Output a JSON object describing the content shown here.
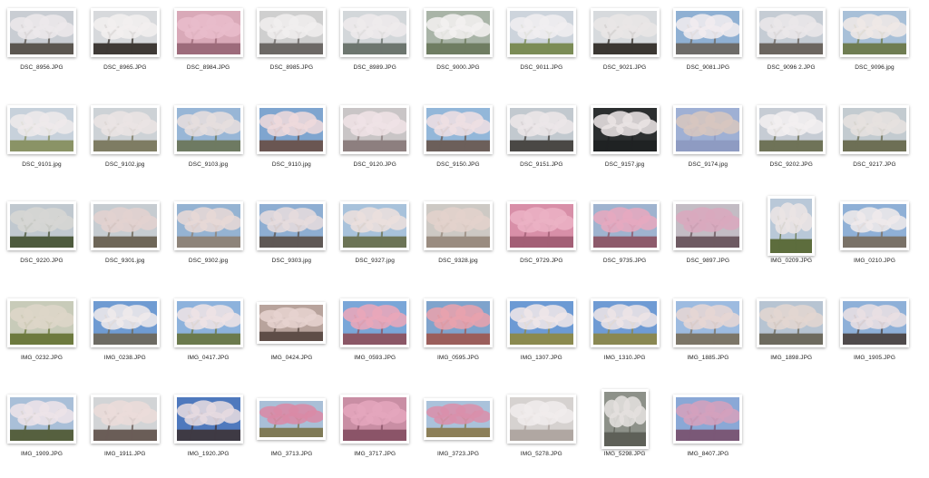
{
  "window": {
    "title": ""
  },
  "files": [
    {
      "name": "DSC_8956.JPG",
      "icon": "blossom-branches-photo",
      "sky": "#c9cdd3",
      "bloom": "#ece8ea",
      "ground": "#5b5650",
      "orient": "landscape"
    },
    {
      "name": "DSC_8965.JPG",
      "icon": "blossom-closeup-photo",
      "sky": "#d7d9dc",
      "bloom": "#f2efef",
      "ground": "#3f3a36",
      "orient": "landscape"
    },
    {
      "name": "DSC_8984.JPG",
      "icon": "pink-blossom-photo",
      "sky": "#d9a9b8",
      "bloom": "#e8bccb",
      "ground": "#9d6b7b",
      "orient": "landscape"
    },
    {
      "name": "DSC_8985.JPG",
      "icon": "white-blossom-photo",
      "sky": "#cfcfcf",
      "bloom": "#f0eeee",
      "ground": "#6c6865",
      "orient": "landscape"
    },
    {
      "name": "DSC_8989.JPG",
      "icon": "blossom-river-photo",
      "sky": "#d3d7da",
      "bloom": "#eeebec",
      "ground": "#6d766f",
      "orient": "landscape"
    },
    {
      "name": "DSC_9000.JPG",
      "icon": "blossom-pond-photo",
      "sky": "#a9b4a7",
      "bloom": "#f2f0f0",
      "ground": "#6f7d62",
      "orient": "landscape"
    },
    {
      "name": "DSC_9011.JPG",
      "icon": "blossom-arch-photo",
      "sky": "#cdd4dc",
      "bloom": "#f0eef0",
      "ground": "#7b8c56",
      "orient": "landscape"
    },
    {
      "name": "DSC_9021.JPG",
      "icon": "bare-tree-photo",
      "sky": "#d7dadd",
      "bloom": "#e9e6e6",
      "ground": "#3b3732",
      "orient": "landscape"
    },
    {
      "name": "DSC_9081.JPG",
      "icon": "blossom-tree-sky-photo",
      "sky": "#8fb0d3",
      "bloom": "#f1ecef",
      "ground": "#6d6b68",
      "orient": "landscape"
    },
    {
      "name": "DSC_9096 2.JPG",
      "icon": "blossom-tree-photo",
      "sky": "#c5ccd4",
      "bloom": "#ebe7e9",
      "ground": "#6b655f",
      "orient": "landscape"
    },
    {
      "name": "DSC_9096.jpg",
      "icon": "blossom-city-photo",
      "sky": "#a8c0d8",
      "bloom": "#efe8e6",
      "ground": "#6f7d52",
      "orient": "landscape"
    },
    {
      "name": "DSC_9101.jpg",
      "icon": "blossom-path-photo",
      "sky": "#c7d1db",
      "bloom": "#eee9ea",
      "ground": "#8a9366",
      "orient": "landscape"
    },
    {
      "name": "DSC_9102.jpg",
      "icon": "blossom-avenue-photo",
      "sky": "#cdd2d6",
      "bloom": "#ebe4e4",
      "ground": "#7e7c63",
      "orient": "landscape"
    },
    {
      "name": "DSC_9103.jpg",
      "icon": "blossom-towers-photo",
      "sky": "#98b6d6",
      "bloom": "#e6dede",
      "ground": "#6e7a62",
      "orient": "landscape"
    },
    {
      "name": "DSC_9110.jpg",
      "icon": "blossom-sky-photo",
      "sky": "#7fa5cf",
      "bloom": "#eed9dc",
      "ground": "#6a5652",
      "orient": "landscape"
    },
    {
      "name": "DSC_9120.JPG",
      "icon": "blossom-cluster-photo",
      "sky": "#c9c5c6",
      "bloom": "#efe3e6",
      "ground": "#8d7f7f",
      "orient": "landscape"
    },
    {
      "name": "DSC_9150.JPG",
      "icon": "blossom-branch-sky-photo",
      "sky": "#93b7d9",
      "bloom": "#eedfe2",
      "ground": "#6c5f5a",
      "orient": "landscape"
    },
    {
      "name": "DSC_9151.JPG",
      "icon": "blossom-canopy-photo",
      "sky": "#c2c9cf",
      "bloom": "#ece6e8",
      "ground": "#4a4845",
      "orient": "landscape"
    },
    {
      "name": "DSC_9157.jpg",
      "icon": "petals-water-photo",
      "sky": "#2c2f30",
      "bloom": "#e9e4e4",
      "ground": "#1f2223",
      "orient": "landscape"
    },
    {
      "name": "DSC_9174.jpg",
      "icon": "petals-lake-photo",
      "sky": "#9fb0d4",
      "bloom": "#d7c6bf",
      "ground": "#8e9bc2",
      "orient": "landscape"
    },
    {
      "name": "DSC_9202.JPG",
      "icon": "blossom-tree-photo",
      "sky": "#c6ccd4",
      "bloom": "#f2eff0",
      "ground": "#6f7358",
      "orient": "landscape"
    },
    {
      "name": "DSC_9217.JPG",
      "icon": "park-tree-photo",
      "sky": "#c3cbd0",
      "bloom": "#e6e1df",
      "ground": "#6d6f55",
      "orient": "landscape"
    },
    {
      "name": "DSC_9220.JPG",
      "icon": "bare-tree-park-photo",
      "sky": "#c0c8cf",
      "bloom": "#d6d6d4",
      "ground": "#4d5a3d",
      "orient": "landscape"
    },
    {
      "name": "DSC_9301.jpg",
      "icon": "blossom-street-photo",
      "sky": "#c6ccd1",
      "bloom": "#e3d2cf",
      "ground": "#6e6658",
      "orient": "landscape"
    },
    {
      "name": "DSC_9302.jpg",
      "icon": "blossom-sky-photo",
      "sky": "#95b3d2",
      "bloom": "#e7d8d6",
      "ground": "#8e847a",
      "orient": "landscape"
    },
    {
      "name": "DSC_9303.jpg",
      "icon": "blossom-branch-photo",
      "sky": "#8eaed2",
      "bloom": "#e6dcdd",
      "ground": "#5f5855",
      "orient": "landscape"
    },
    {
      "name": "DSC_9327.jpg",
      "icon": "blossom-road-photo",
      "sky": "#a8c2db",
      "bloom": "#eadfdd",
      "ground": "#6c7456",
      "orient": "landscape"
    },
    {
      "name": "DSC_9328.jpg",
      "icon": "blossom-grove-photo",
      "sky": "#cdc9c4",
      "bloom": "#e2d2cc",
      "ground": "#9a8c80",
      "orient": "landscape"
    },
    {
      "name": "DSC_9729.JPG",
      "icon": "pink-blossom-photo",
      "sky": "#d88fa8",
      "bloom": "#eab2c4",
      "ground": "#a35f76",
      "orient": "landscape"
    },
    {
      "name": "DSC_9735.JPG",
      "icon": "pink-blossom-sky-photo",
      "sky": "#9fb3cf",
      "bloom": "#e6a9bf",
      "ground": "#8d5a6b",
      "orient": "landscape"
    },
    {
      "name": "DSC_9897.JPG",
      "icon": "pink-tree-photo",
      "sky": "#c3bcc4",
      "bloom": "#d9a9be",
      "ground": "#6e5a62",
      "orient": "landscape"
    },
    {
      "name": "IMG_0209.JPG",
      "icon": "blossom-house-photo",
      "sky": "#b9c8d8",
      "bloom": "#eae4e4",
      "ground": "#5d6d3d",
      "orient": "portrait"
    },
    {
      "name": "IMG_0210.JPG",
      "icon": "blossom-house-sky-photo",
      "sky": "#8fb0d6",
      "bloom": "#efe9ea",
      "ground": "#7a7268",
      "orient": "landscape"
    },
    {
      "name": "IMG_0232.JPG",
      "icon": "park-bench-photo",
      "sky": "#c8cbb9",
      "bloom": "#ddd6c8",
      "ground": "#6d7a3e",
      "orient": "landscape"
    },
    {
      "name": "IMG_0238.JPG",
      "icon": "blossom-tree-sky-photo",
      "sky": "#6f9bd2",
      "bloom": "#efe9ea",
      "ground": "#6d6b63",
      "orient": "landscape"
    },
    {
      "name": "IMG_0417.JPG",
      "icon": "blossom-path-sky-photo",
      "sky": "#8db2dc",
      "bloom": "#eee3e5",
      "ground": "#6b7a4d",
      "orient": "landscape"
    },
    {
      "name": "IMG_0424.JPG",
      "icon": "petals-ground-photo",
      "sky": "#b8a39c",
      "bloom": "#e6d3cf",
      "ground": "#5e4d47",
      "orient": "wide"
    },
    {
      "name": "IMG_0593.JPG",
      "icon": "pink-blossom-sky-photo",
      "sky": "#7aa6d8",
      "bloom": "#e9a7b9",
      "ground": "#8b5766",
      "orient": "landscape"
    },
    {
      "name": "IMG_0595.JPG",
      "icon": "pink-blossom-closeup-photo",
      "sky": "#7fa3cc",
      "bloom": "#e8a2ad",
      "ground": "#9b5e5b",
      "orient": "landscape"
    },
    {
      "name": "IMG_1307.JPG",
      "icon": "blossom-field-photo",
      "sky": "#6c9ad4",
      "bloom": "#efe6e8",
      "ground": "#8b8a4f",
      "orient": "landscape"
    },
    {
      "name": "IMG_1310.JPG",
      "icon": "blossom-field-sky-photo",
      "sky": "#6f9bd4",
      "bloom": "#ede4e6",
      "ground": "#8a8852",
      "orient": "landscape"
    },
    {
      "name": "IMG_1885.JPG",
      "icon": "blossom-valley-photo",
      "sky": "#9dbbe0",
      "bloom": "#e6d6d4",
      "ground": "#7c7668",
      "orient": "landscape"
    },
    {
      "name": "IMG_1898.JPG",
      "icon": "blossom-rows-photo",
      "sky": "#b7c4d2",
      "bloom": "#e3d6d0",
      "ground": "#6d6a5e",
      "orient": "landscape"
    },
    {
      "name": "IMG_1905.JPG",
      "icon": "blossom-branches-sky-photo",
      "sky": "#8eb0d8",
      "bloom": "#e9dfe3",
      "ground": "#4f4a4b",
      "orient": "landscape"
    },
    {
      "name": "IMG_1909.JPG",
      "icon": "blossom-riverbank-photo",
      "sky": "#a9bfd8",
      "bloom": "#ede4e8",
      "ground": "#56603f",
      "orient": "landscape"
    },
    {
      "name": "IMG_1911.JPG",
      "icon": "blossom-branches-photo",
      "sky": "#d2d4d6",
      "bloom": "#eadcd9",
      "ground": "#6a5d57",
      "orient": "landscape"
    },
    {
      "name": "IMG_1920.JPG",
      "icon": "blossom-sky-photo",
      "sky": "#4f79bd",
      "bloom": "#e6dbe0",
      "ground": "#3e3a44",
      "orient": "landscape"
    },
    {
      "name": "IMG_3713.JPG",
      "icon": "pink-river-photo",
      "sky": "#a9bfd7",
      "bloom": "#d98aa6",
      "ground": "#7f7a56",
      "orient": "wide"
    },
    {
      "name": "IMG_3717.JPG",
      "icon": "pink-blossom-photo",
      "sky": "#c98ea4",
      "bloom": "#e4a6bd",
      "ground": "#8b5468",
      "orient": "landscape"
    },
    {
      "name": "IMG_3723.JPG",
      "icon": "pink-river-photo",
      "sky": "#aac2db",
      "bloom": "#d990ab",
      "ground": "#8c7f58",
      "orient": "wide"
    },
    {
      "name": "IMG_5278.JPG",
      "icon": "white-blossom-closeup-photo",
      "sky": "#d6d2d0",
      "bloom": "#f0ecec",
      "ground": "#b0a7a2",
      "orient": "landscape"
    },
    {
      "name": "IMG_5298.JPG",
      "icon": "petals-ground-photo",
      "sky": "#8d9189",
      "bloom": "#e4e0de",
      "ground": "#5e6058",
      "orient": "portrait"
    },
    {
      "name": "IMG_8407.JPG",
      "icon": "pink-blossom-sky-photo",
      "sky": "#8aa8d6",
      "bloom": "#d4a0bd",
      "ground": "#7a5877",
      "orient": "landscape"
    }
  ]
}
